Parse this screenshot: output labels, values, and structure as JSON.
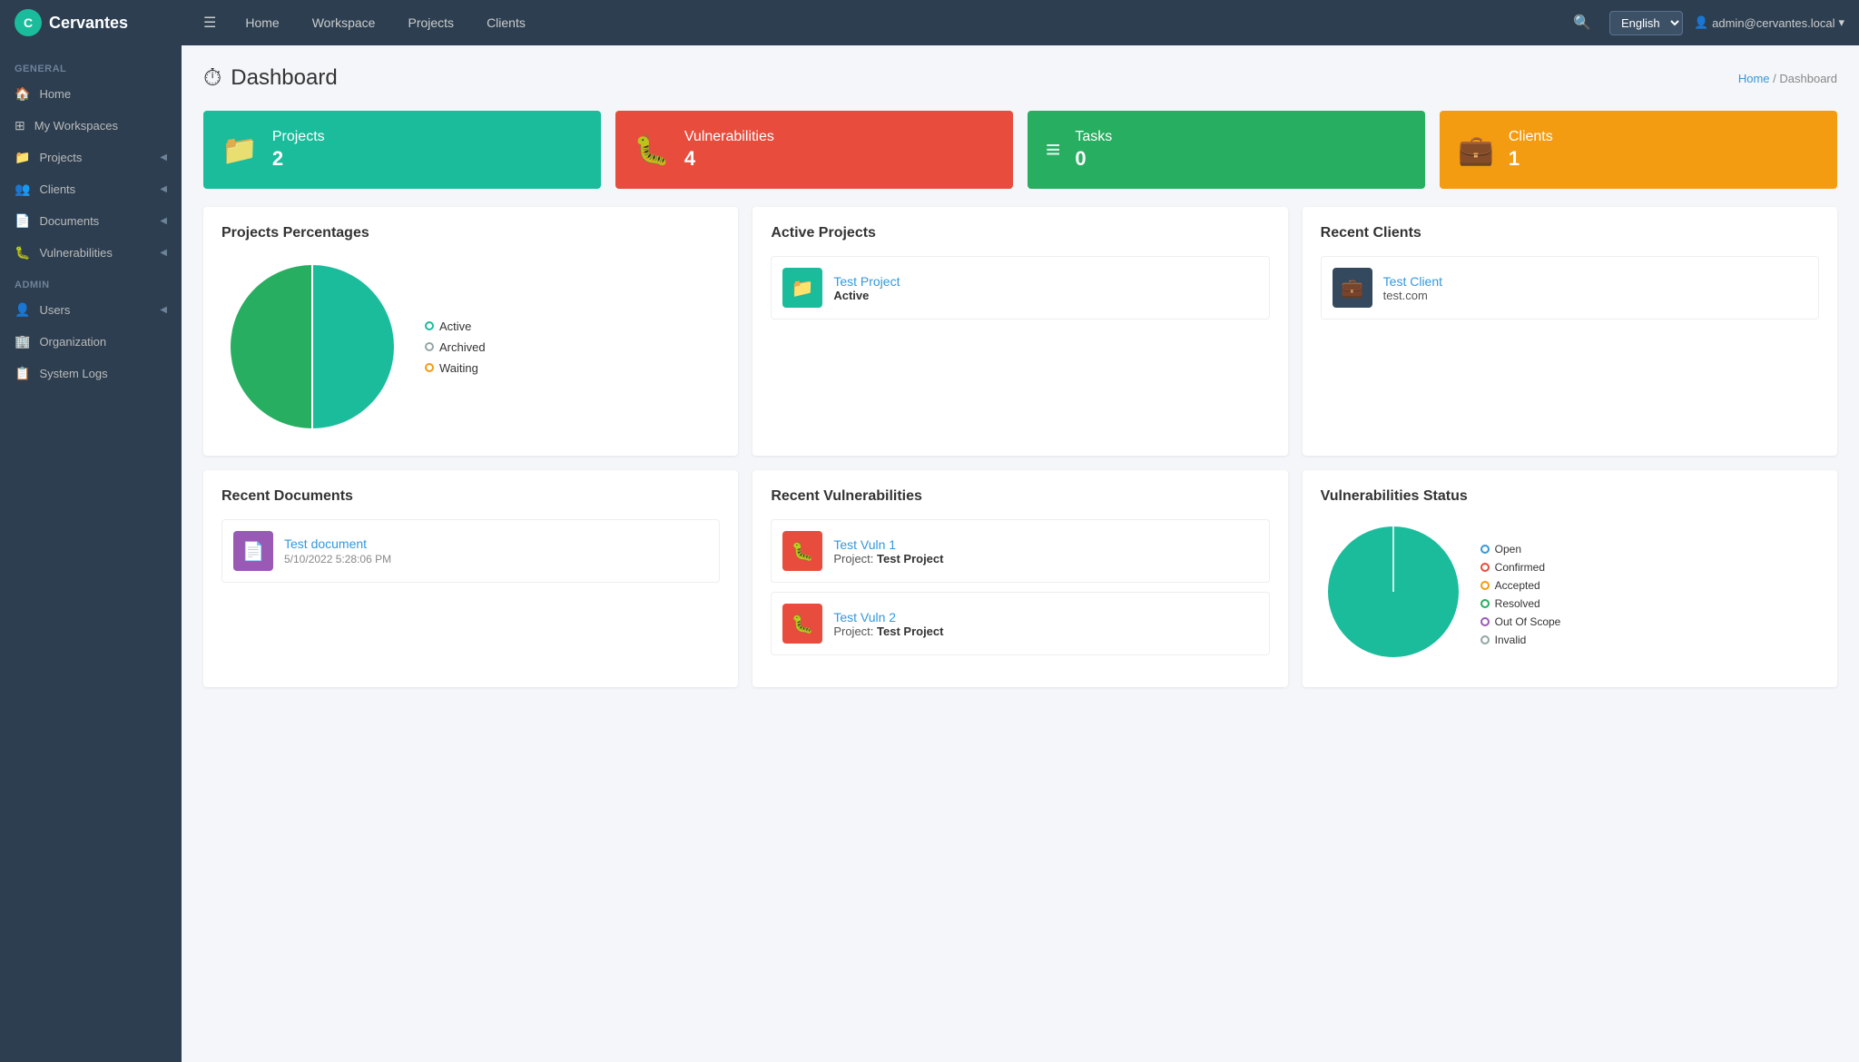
{
  "app": {
    "name": "Cervantes",
    "logo_text": "C"
  },
  "topnav": {
    "links": [
      "Home",
      "Workspace",
      "Projects",
      "Clients"
    ],
    "language": "English",
    "user": "admin@cervantes.local",
    "menu_icon": "☰"
  },
  "sidebar": {
    "general_label": "GENERAL",
    "admin_label": "ADMIN",
    "general_items": [
      {
        "label": "Home",
        "icon": "🏠"
      },
      {
        "label": "My Workspaces",
        "icon": "⊞"
      },
      {
        "label": "Projects",
        "icon": "📁",
        "has_chevron": true
      },
      {
        "label": "Clients",
        "icon": "👥",
        "has_chevron": true
      },
      {
        "label": "Documents",
        "icon": "📄",
        "has_chevron": true
      },
      {
        "label": "Vulnerabilities",
        "icon": "🐛",
        "has_chevron": true
      }
    ],
    "admin_items": [
      {
        "label": "Users",
        "icon": "👤",
        "has_chevron": true
      },
      {
        "label": "Organization",
        "icon": "🏢"
      },
      {
        "label": "System Logs",
        "icon": "📋"
      }
    ]
  },
  "page": {
    "title": "Dashboard",
    "breadcrumb_home": "Home",
    "breadcrumb_current": "Dashboard",
    "icon": "⏱"
  },
  "stats": [
    {
      "label": "Projects",
      "value": "2",
      "icon": "📁",
      "color": "teal"
    },
    {
      "label": "Vulnerabilities",
      "value": "4",
      "icon": "🐛",
      "color": "red"
    },
    {
      "label": "Tasks",
      "value": "0",
      "icon": "≡",
      "color": "green"
    },
    {
      "label": "Clients",
      "value": "1",
      "icon": "💼",
      "color": "yellow"
    }
  ],
  "projects_percentages": {
    "title": "Projects Percentages",
    "legend": [
      {
        "label": "Active",
        "color_class": "teal-border"
      },
      {
        "label": "Archived",
        "color_class": "gray-border"
      },
      {
        "label": "Waiting",
        "color_class": "yellow-border"
      }
    ],
    "chart": {
      "active_pct": 50,
      "archived_pct": 50,
      "waiting_pct": 0
    }
  },
  "active_projects": {
    "title": "Active Projects",
    "items": [
      {
        "name": "Test Project",
        "status": "Active"
      }
    ]
  },
  "recent_clients": {
    "title": "Recent Clients",
    "items": [
      {
        "name": "Test Client",
        "domain": "test.com"
      }
    ]
  },
  "recent_documents": {
    "title": "Recent Documents",
    "items": [
      {
        "name": "Test document",
        "date": "5/10/2022 5:28:06 PM"
      }
    ]
  },
  "recent_vulnerabilities": {
    "title": "Recent Vulnerabilities",
    "items": [
      {
        "name": "Test Vuln 1",
        "project": "Test Project"
      },
      {
        "name": "Test Vuln 2",
        "project": "Test Project"
      }
    ]
  },
  "vulnerabilities_status": {
    "title": "Vulnerabilities Status",
    "legend": [
      {
        "label": "Open",
        "color_class": "dot-blue"
      },
      {
        "label": "Confirmed",
        "color_class": "dot-red"
      },
      {
        "label": "Accepted",
        "color_class": "dot-yellow"
      },
      {
        "label": "Resolved",
        "color_class": "dot-green"
      },
      {
        "label": "Out Of Scope",
        "color_class": "dot-purple"
      },
      {
        "label": "Invalid",
        "color_class": "dot-gray"
      }
    ]
  }
}
